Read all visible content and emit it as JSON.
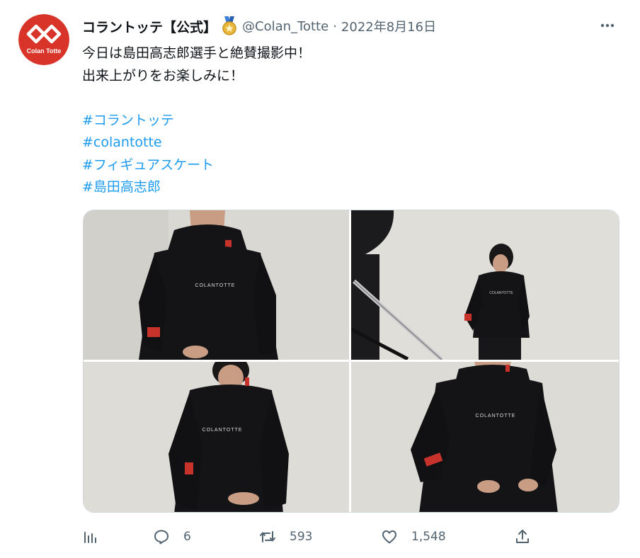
{
  "author": {
    "logo_text": "Colan Totte",
    "display_name": "コラントッテ【公式】",
    "badge_icon": "gold-affiliate-badge-icon",
    "handle": "@Colan_Totte",
    "separator": "·",
    "timestamp": "2022年8月16日"
  },
  "tweet": {
    "lines": [
      "今日は島田高志郎選手と絶賛撮影中！",
      "出来上がりをお楽しみに！"
    ],
    "hashtags": [
      "#コラントッテ",
      "#colantotte",
      "#フィギュアスケート",
      "#島田高志郎"
    ]
  },
  "media": {
    "photos": [
      {
        "print": "COLANTOTTE"
      },
      {
        "print": "COLANTOTTE"
      },
      {
        "print": "COLANTOTTE"
      },
      {
        "print": "COLANTOTTE"
      }
    ]
  },
  "actions": {
    "views_icon": "bar-chart-icon",
    "reply_icon": "speech-bubble-icon",
    "reply_count": "6",
    "retweet_icon": "retweet-icon",
    "retweet_count": "593",
    "like_icon": "heart-icon",
    "like_count": "1,548",
    "share_icon": "share-upload-icon"
  },
  "colors": {
    "brand_red": "#d8342a",
    "hashtag": "#1d9bf0",
    "secondary_text": "#536471",
    "primary_text": "#0f1419"
  }
}
